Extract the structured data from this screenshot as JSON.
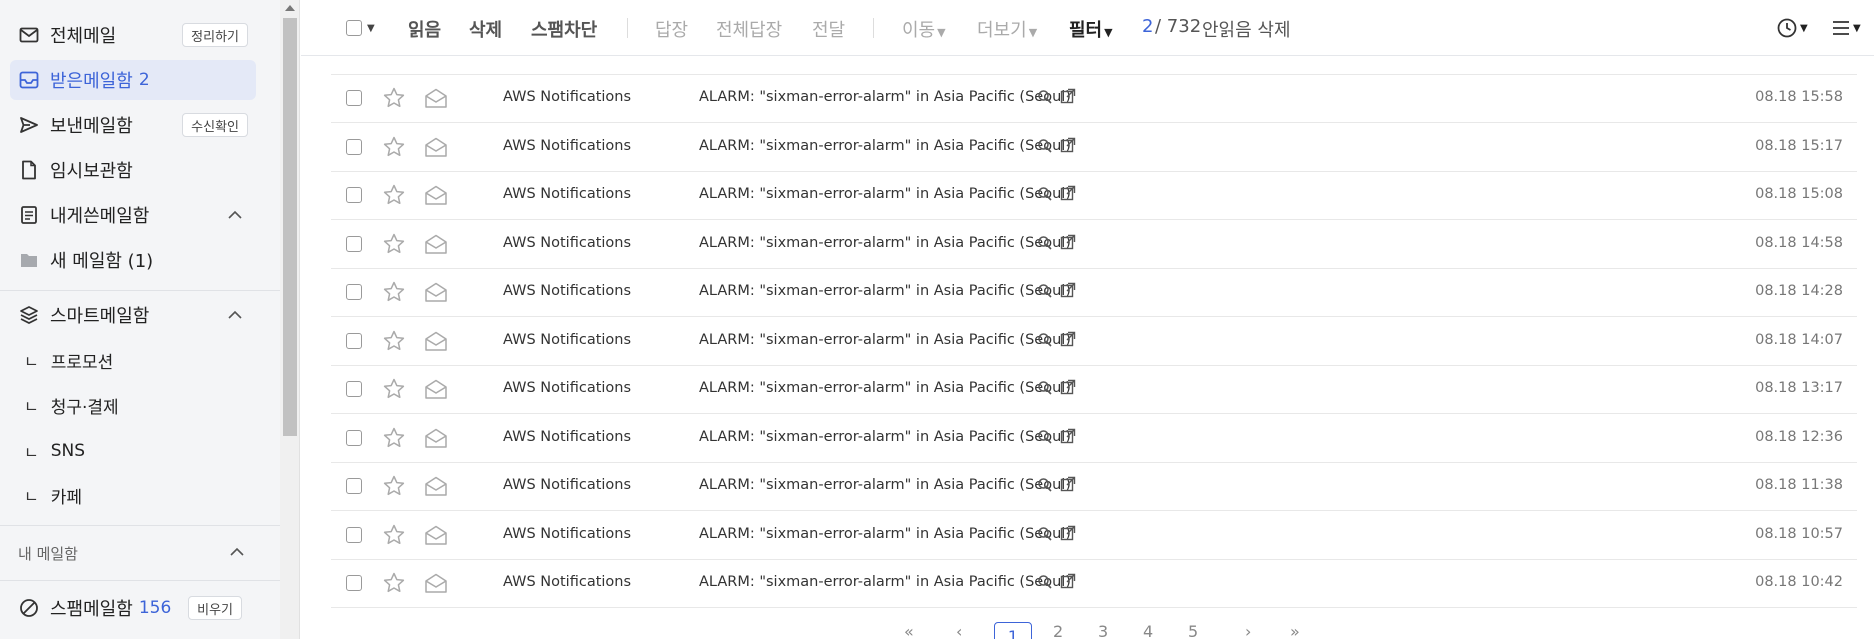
{
  "sidebar": {
    "all_mail": {
      "label": "전체메일",
      "button": "정리하기"
    },
    "inbox": {
      "label": "받은메일함",
      "count": "2"
    },
    "sent": {
      "label": "보낸메일함",
      "button": "수신확인"
    },
    "drafts": {
      "label": "임시보관함"
    },
    "to_me": {
      "label": "내게쓴메일함"
    },
    "new_box": {
      "label": "새 메일함 (1)"
    },
    "smart": {
      "label": "스마트메일함"
    },
    "smart_items": [
      "프로모션",
      "청구·결제",
      "SNS",
      "카페"
    ],
    "my_boxes": {
      "label": "내 메일함"
    },
    "spam": {
      "label": "스팸메일함",
      "count": "156",
      "button": "비우기"
    },
    "tree_glyph": "ㄴ"
  },
  "toolbar": {
    "read": "읽음",
    "delete": "삭제",
    "spam_block": "스팸차단",
    "reply": "답장",
    "reply_all": "전체답장",
    "forward": "전달",
    "move": "이동",
    "more": "더보기",
    "filter": "필터",
    "unread_count": "2",
    "total": "/ 732",
    "delete_unread": "안읽음 삭제"
  },
  "mails": [
    {
      "sender": "AWS Notifications",
      "subject": "ALARM: \"sixman-error-alarm\" in Asia Pacific (Seoul)",
      "date": "08.18 15:58"
    },
    {
      "sender": "AWS Notifications",
      "subject": "ALARM: \"sixman-error-alarm\" in Asia Pacific (Seoul)",
      "date": "08.18 15:17"
    },
    {
      "sender": "AWS Notifications",
      "subject": "ALARM: \"sixman-error-alarm\" in Asia Pacific (Seoul)",
      "date": "08.18 15:08"
    },
    {
      "sender": "AWS Notifications",
      "subject": "ALARM: \"sixman-error-alarm\" in Asia Pacific (Seoul)",
      "date": "08.18 14:58"
    },
    {
      "sender": "AWS Notifications",
      "subject": "ALARM: \"sixman-error-alarm\" in Asia Pacific (Seoul)",
      "date": "08.18 14:28"
    },
    {
      "sender": "AWS Notifications",
      "subject": "ALARM: \"sixman-error-alarm\" in Asia Pacific (Seoul)",
      "date": "08.18 14:07"
    },
    {
      "sender": "AWS Notifications",
      "subject": "ALARM: \"sixman-error-alarm\" in Asia Pacific (Seoul)",
      "date": "08.18 13:17"
    },
    {
      "sender": "AWS Notifications",
      "subject": "ALARM: \"sixman-error-alarm\" in Asia Pacific (Seoul)",
      "date": "08.18 12:36"
    },
    {
      "sender": "AWS Notifications",
      "subject": "ALARM: \"sixman-error-alarm\" in Asia Pacific (Seoul)",
      "date": "08.18 11:38"
    },
    {
      "sender": "AWS Notifications",
      "subject": "ALARM: \"sixman-error-alarm\" in Asia Pacific (Seoul)",
      "date": "08.18 10:57"
    },
    {
      "sender": "AWS Notifications",
      "subject": "ALARM: \"sixman-error-alarm\" in Asia Pacific (Seoul)",
      "date": "08.18 10:42"
    }
  ],
  "pagination": {
    "current": "1",
    "pages": [
      "2",
      "3",
      "4",
      "5"
    ],
    "first": "«",
    "prev": "‹",
    "next": "›",
    "last": "»"
  },
  "colors": {
    "accent": "#3d64d8",
    "sidebar_bg": "#f4f5f7",
    "active_bg": "#e4e9f7"
  }
}
